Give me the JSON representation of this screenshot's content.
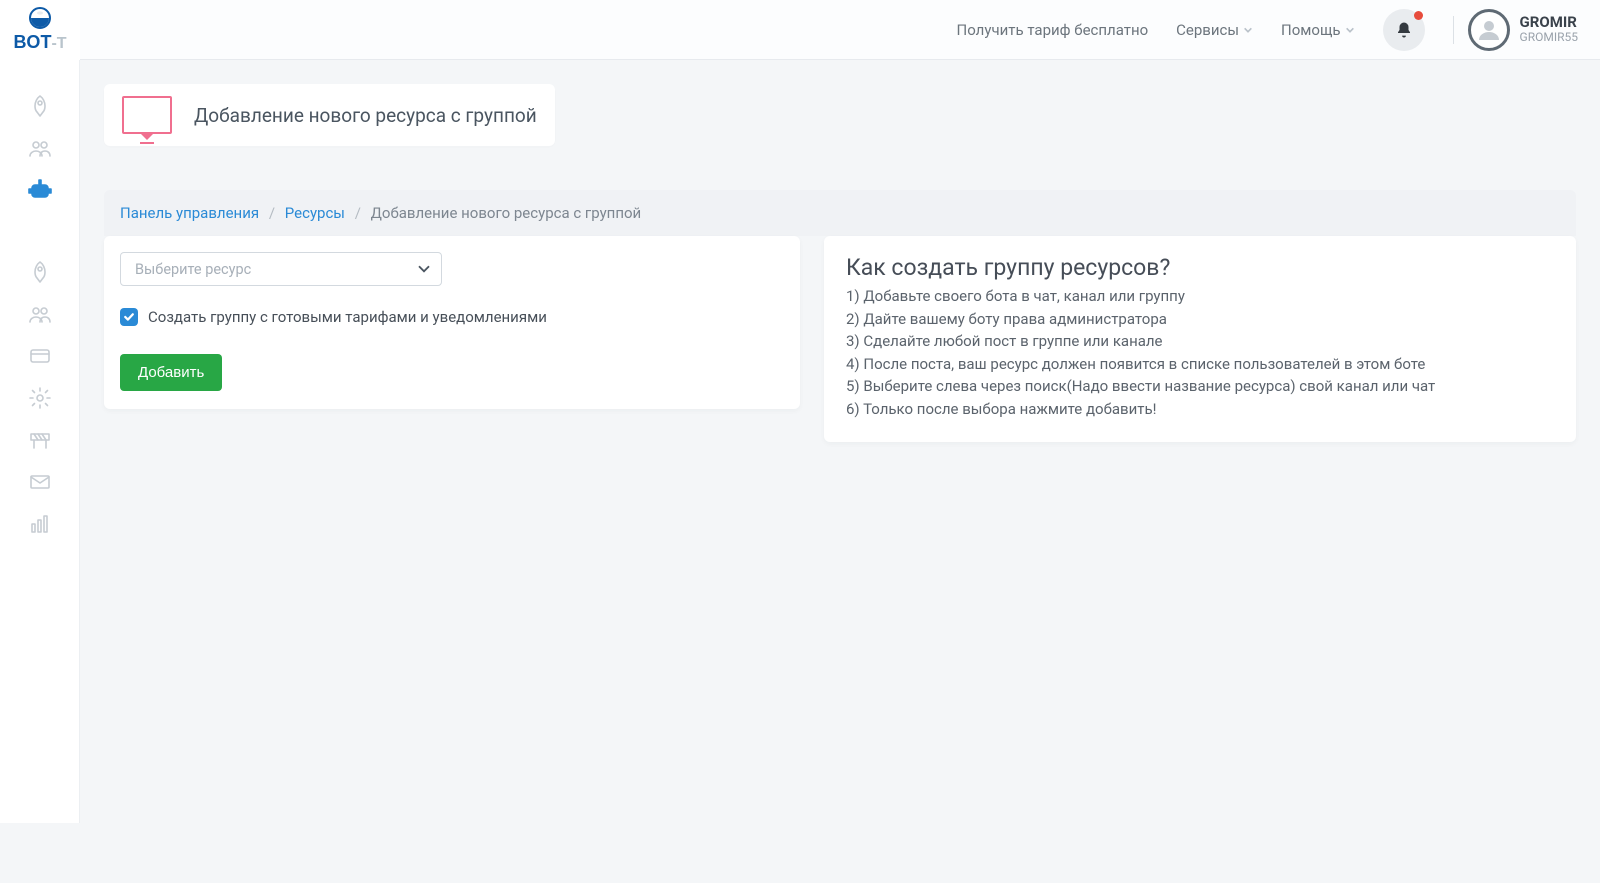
{
  "header": {
    "free_tariff_link": "Получить тариф бесплатно",
    "services_label": "Сервисы",
    "help_label": "Помощь",
    "user": {
      "name": "GROMIR",
      "handle": "GROMIR55"
    }
  },
  "page": {
    "title": "Добавление нового ресурса с группой"
  },
  "breadcrumb": {
    "dashboard": "Панель управления",
    "resources": "Ресурсы",
    "current": "Добавление нового ресурса с группой"
  },
  "form": {
    "select_placeholder": "Выберите ресурс",
    "checkbox_label": "Создать группу с готовыми тарифами и уведомлениями",
    "checkbox_checked": true,
    "submit_label": "Добавить"
  },
  "help": {
    "title": "Как создать группу ресурсов?",
    "steps": [
      "1) Добавьте своего бота в чат, канал или группу",
      "2) Дайте вашему боту права администратора",
      "3) Сделайте любой пост в группе или канале",
      "4) После поста, ваш ресурс должен появится в списке пользователей в этом боте",
      "5) Выберите слева через поиск(Надо ввести название ресурса) свой канал или чат",
      "6) Только после выбора нажмите добавить!"
    ]
  },
  "sidebar": {
    "items": [
      {
        "name": "sidebar-rocket",
        "icon": "rocket",
        "active": false
      },
      {
        "name": "sidebar-users",
        "icon": "users",
        "active": false
      },
      {
        "name": "sidebar-robot",
        "icon": "robot",
        "active": true
      },
      {
        "name": "sidebar-rocket-2",
        "icon": "rocket",
        "active": false,
        "gap": true
      },
      {
        "name": "sidebar-users-2",
        "icon": "users",
        "active": false
      },
      {
        "name": "sidebar-card",
        "icon": "card",
        "active": false
      },
      {
        "name": "sidebar-gear",
        "icon": "gear",
        "active": false
      },
      {
        "name": "sidebar-barrier",
        "icon": "barrier",
        "active": false
      },
      {
        "name": "sidebar-mail",
        "icon": "mail",
        "active": false
      },
      {
        "name": "sidebar-stats",
        "icon": "stats",
        "active": false
      }
    ]
  }
}
